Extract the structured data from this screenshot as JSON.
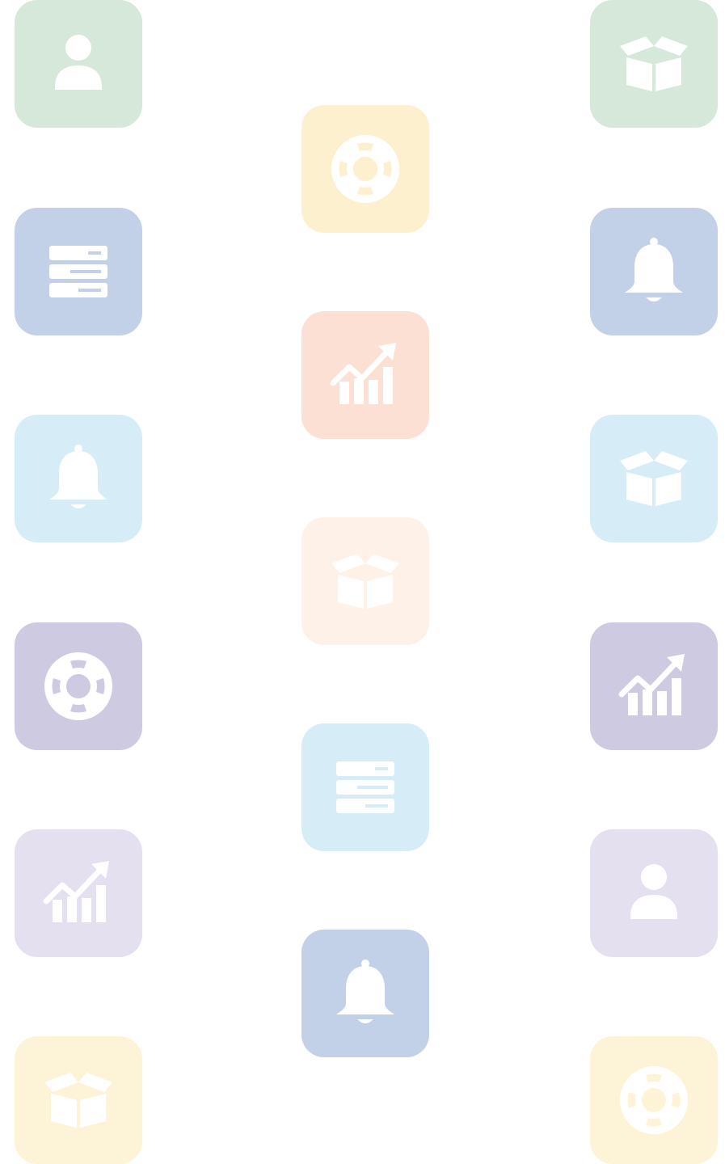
{
  "tiles": [
    {
      "icon": "user-icon",
      "color": "#d5e8d9"
    },
    {
      "icon": "box-icon",
      "color": "#d5e8d9"
    },
    {
      "icon": "lifebuoy-icon",
      "color": "#fdf0cf"
    },
    {
      "icon": "server-icon",
      "color": "#c2d0e8"
    },
    {
      "icon": "bell-icon",
      "color": "#c2d0e8"
    },
    {
      "icon": "chart-icon",
      "color": "#fbe0d3"
    },
    {
      "icon": "bell-icon",
      "color": "#d6edf8"
    },
    {
      "icon": "box-icon",
      "color": "#d6edf8"
    },
    {
      "icon": "box-icon",
      "color": "#fdf1e8"
    },
    {
      "icon": "lifebuoy-icon",
      "color": "#cdcae2"
    },
    {
      "icon": "chart-icon",
      "color": "#cdcae2"
    },
    {
      "icon": "server-icon",
      "color": "#d6edf8"
    },
    {
      "icon": "chart-icon",
      "color": "#e4e0f0"
    },
    {
      "icon": "user-icon",
      "color": "#e4e0f0"
    },
    {
      "icon": "bell-icon",
      "color": "#c2d0e8"
    },
    {
      "icon": "box-icon",
      "color": "#fdf4d8"
    },
    {
      "icon": "lifebuoy-icon",
      "color": "#fdf4d8"
    }
  ]
}
